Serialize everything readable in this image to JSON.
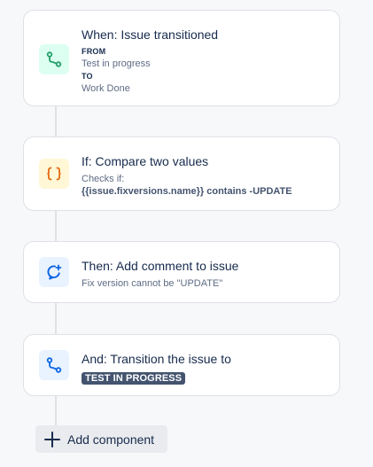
{
  "cards": [
    {
      "icon": "branch-icon",
      "title": "When: Issue transitioned",
      "from_label": "FROM",
      "from_value": "Test in progress",
      "to_label": "TO",
      "to_value": "Work Done"
    },
    {
      "icon": "braces-icon",
      "title": "If: Compare two values",
      "checks_label": "Checks if:",
      "condition": "{{issue.fixversions.name}} contains -UPDATE"
    },
    {
      "icon": "comment-add-icon",
      "title": "Then: Add comment to issue",
      "description": "Fix version cannot be \"UPDATE\""
    },
    {
      "icon": "branch-icon",
      "title": "And: Transition the issue to",
      "status": "TEST IN PROGRESS"
    }
  ],
  "add_component": {
    "label": "Add component",
    "icon": "plus-icon"
  },
  "colors": {
    "trigger_icon_bg": "#dcfff1",
    "trigger_icon_fg": "#22a06b",
    "condition_icon_bg": "#fff7d6",
    "condition_icon_fg": "#e56910",
    "action_icon_bg": "#e9f2ff",
    "action_icon_fg": "#0c66e4",
    "status_lozenge": "#44546f"
  }
}
